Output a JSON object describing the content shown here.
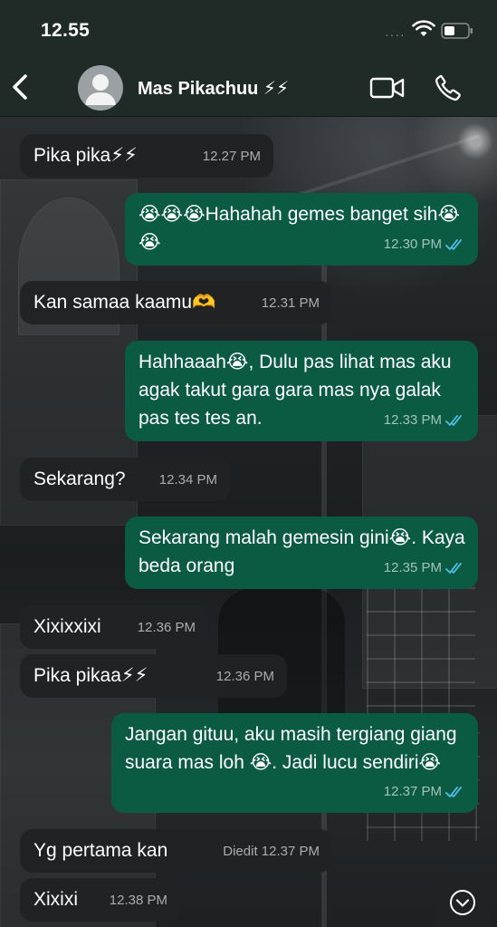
{
  "status": {
    "time": "12.55",
    "signal": "····"
  },
  "header": {
    "contact_name": "Mas Pikachuu ⚡⚡"
  },
  "colors": {
    "header": "#202a27",
    "incoming": "#202224",
    "outgoing": "#0b5b43",
    "read_ticks": "#53bdeb"
  },
  "messages": [
    {
      "dir": "in",
      "text": "Pika pika⚡⚡",
      "time": "12.27 PM"
    },
    {
      "dir": "out",
      "text": "😭😭😭Hahahah gemes banget sih😭😭",
      "time": "12.30 PM",
      "read": true
    },
    {
      "dir": "in",
      "text": "Kan samaa kaamu🫶",
      "time": "12.31 PM"
    },
    {
      "dir": "out",
      "text": "Hahhaaah😭, Dulu pas lihat mas aku agak takut gara gara mas nya galak pas tes tes an.",
      "time": "12.33 PM",
      "read": true
    },
    {
      "dir": "in",
      "text": "Sekarang?",
      "time": "12.34 PM"
    },
    {
      "dir": "out",
      "text": "Sekarang malah gemesin gini😭. Kaya beda orang",
      "time": "12.35 PM",
      "read": true
    },
    {
      "dir": "in",
      "text": "Xixixxixi",
      "time": "12.36 PM"
    },
    {
      "dir": "in",
      "text": "Pika pikaa⚡⚡",
      "time": "12.36 PM"
    },
    {
      "dir": "out",
      "text": "Jangan gituu, aku masih tergiang giang suara mas loh 😭. Jadi lucu sendiri😭",
      "time": "12.37 PM",
      "read": true
    },
    {
      "dir": "in",
      "text": "Yg pertama kan",
      "time": "Diedit 12.37 PM"
    },
    {
      "dir": "in",
      "text": "Xixixi",
      "time": "12.38 PM"
    }
  ]
}
